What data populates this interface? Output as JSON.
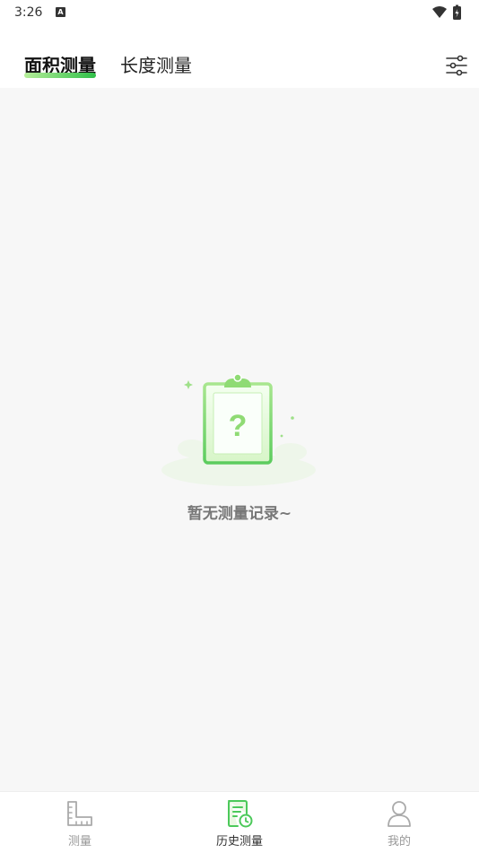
{
  "status_bar": {
    "time": "3:26",
    "notification_letter": "A"
  },
  "header": {
    "tabs": [
      {
        "label": "面积测量",
        "active": true
      },
      {
        "label": "长度测量",
        "active": false
      }
    ],
    "filter_icon": "sliders-icon"
  },
  "empty_state": {
    "illustration_icon": "clipboard-question-icon",
    "text": "暂无测量记录~"
  },
  "bottom_nav": {
    "items": [
      {
        "label": "测量",
        "icon": "ruler-icon",
        "active": false
      },
      {
        "label": "历史测量",
        "icon": "history-document-icon",
        "active": true
      },
      {
        "label": "我的",
        "icon": "user-icon",
        "active": false
      }
    ]
  },
  "colors": {
    "accent": "#4cc95a",
    "accent_light": "#b6ee9a",
    "background": "#f7f7f7",
    "inactive": "#999999"
  }
}
